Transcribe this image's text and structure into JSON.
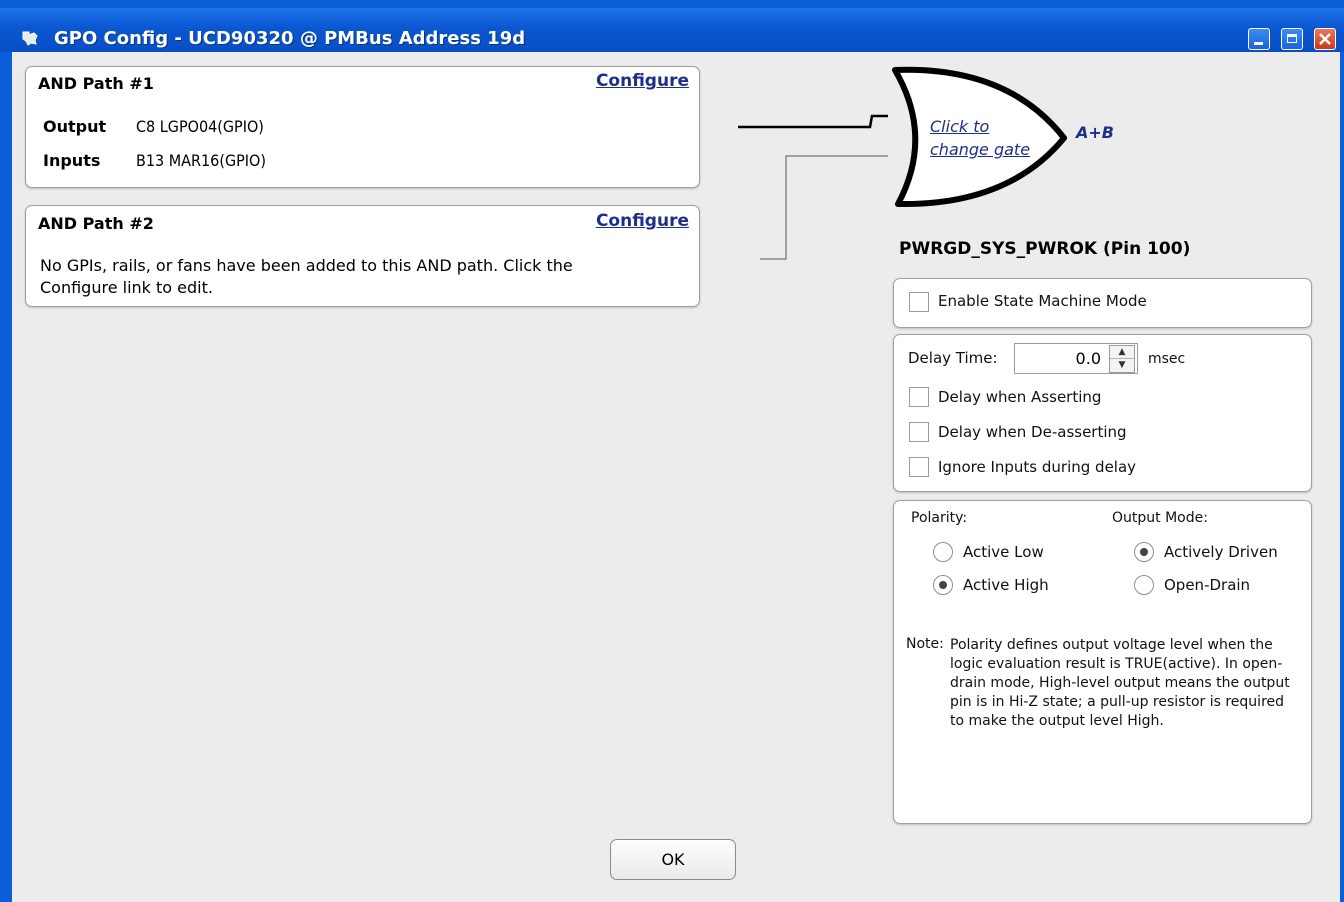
{
  "window": {
    "title": "GPO Config - UCD90320 @ PMBus Address 19d",
    "icon": "ti-logo-icon",
    "controls": [
      "minimize",
      "maximize",
      "close"
    ]
  },
  "and_paths": [
    {
      "title": "AND Path #1",
      "configure_label": "Configure",
      "output_label": "Output",
      "output_value": "C8 LGPO04(GPIO)",
      "inputs_label": "Inputs",
      "inputs_value": "B13 MAR16(GPIO)"
    },
    {
      "title": "AND Path #2",
      "configure_label": "Configure",
      "message": "No GPIs, rails, or fans have been added to this AND path. Click the Configure link to edit."
    }
  ],
  "gate": {
    "link_line1": "Click to",
    "link_line2": "change gate",
    "expression": "A+B",
    "type": "or-gate"
  },
  "pin": {
    "title": "PWRGD_SYS_PWROK (Pin 100)"
  },
  "state_machine": {
    "label": "Enable State Machine Mode",
    "checked": false
  },
  "delay": {
    "label": "Delay Time:",
    "value": "0.0",
    "unit": "msec",
    "options": [
      {
        "label": "Delay when Asserting",
        "checked": false
      },
      {
        "label": "Delay when De-asserting",
        "checked": false
      },
      {
        "label": "Ignore Inputs during delay",
        "checked": false
      }
    ]
  },
  "polarity": {
    "label": "Polarity:",
    "options": [
      {
        "label": "Active Low",
        "selected": false
      },
      {
        "label": "Active High",
        "selected": true
      }
    ]
  },
  "output_mode": {
    "label": "Output Mode:",
    "options": [
      {
        "label": "Actively Driven",
        "selected": true
      },
      {
        "label": "Open-Drain",
        "selected": false
      }
    ]
  },
  "note": {
    "head": "Note:",
    "body": "Polarity defines output voltage level when the logic evaluation result is TRUE(active). In open-drain mode, High-level output means the output pin is in Hi-Z state; a pull-up resistor is required to make the output level High."
  },
  "ok_label": "OK",
  "colors": {
    "titlebar": "#0a57d2",
    "link": "#1d2f8a",
    "panel_border": "#9f9f9f",
    "background": "#ececec"
  }
}
